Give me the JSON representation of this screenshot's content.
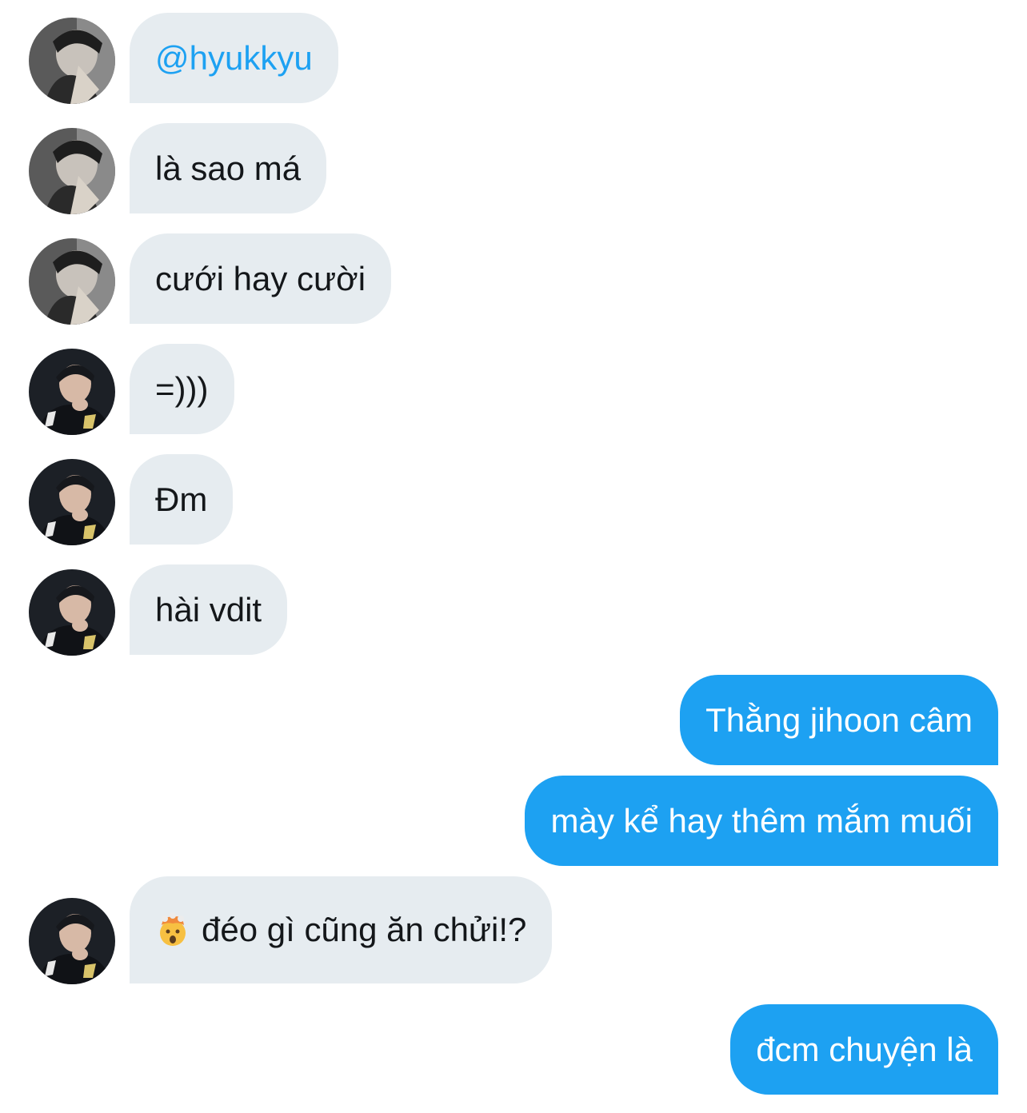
{
  "conversation": {
    "messages": [
      {
        "sender": "hyukkyu-avatar",
        "text": "@hyukkyu",
        "direction": "incoming",
        "is_mention": true
      },
      {
        "sender": "hyukkyu-avatar",
        "text": "là sao má",
        "direction": "incoming"
      },
      {
        "sender": "hyukkyu-avatar",
        "text": "cưới hay cười",
        "direction": "incoming"
      },
      {
        "sender": "jihoon-avatar",
        "text": "=)))",
        "direction": "incoming"
      },
      {
        "sender": "jihoon-avatar",
        "text": "Đm",
        "direction": "incoming"
      },
      {
        "sender": "jihoon-avatar",
        "text": "hài vdit",
        "direction": "incoming"
      },
      {
        "text": "Thằng jihoon câm",
        "direction": "outgoing"
      },
      {
        "text": "mày kể hay thêm mắm muối",
        "direction": "outgoing"
      },
      {
        "sender": "jihoon-avatar",
        "emoji": "exploding-head-icon",
        "text": "đéo gì cũng ăn chửi!?",
        "direction": "incoming"
      },
      {
        "text": "đcm chuyện là",
        "direction": "outgoing"
      }
    ]
  },
  "colors": {
    "incoming_bubble": "#e6ecf0",
    "outgoing_bubble": "#1da1f2",
    "mention": "#1da1f2",
    "text_dark": "#14171a",
    "text_light": "#ffffff"
  }
}
